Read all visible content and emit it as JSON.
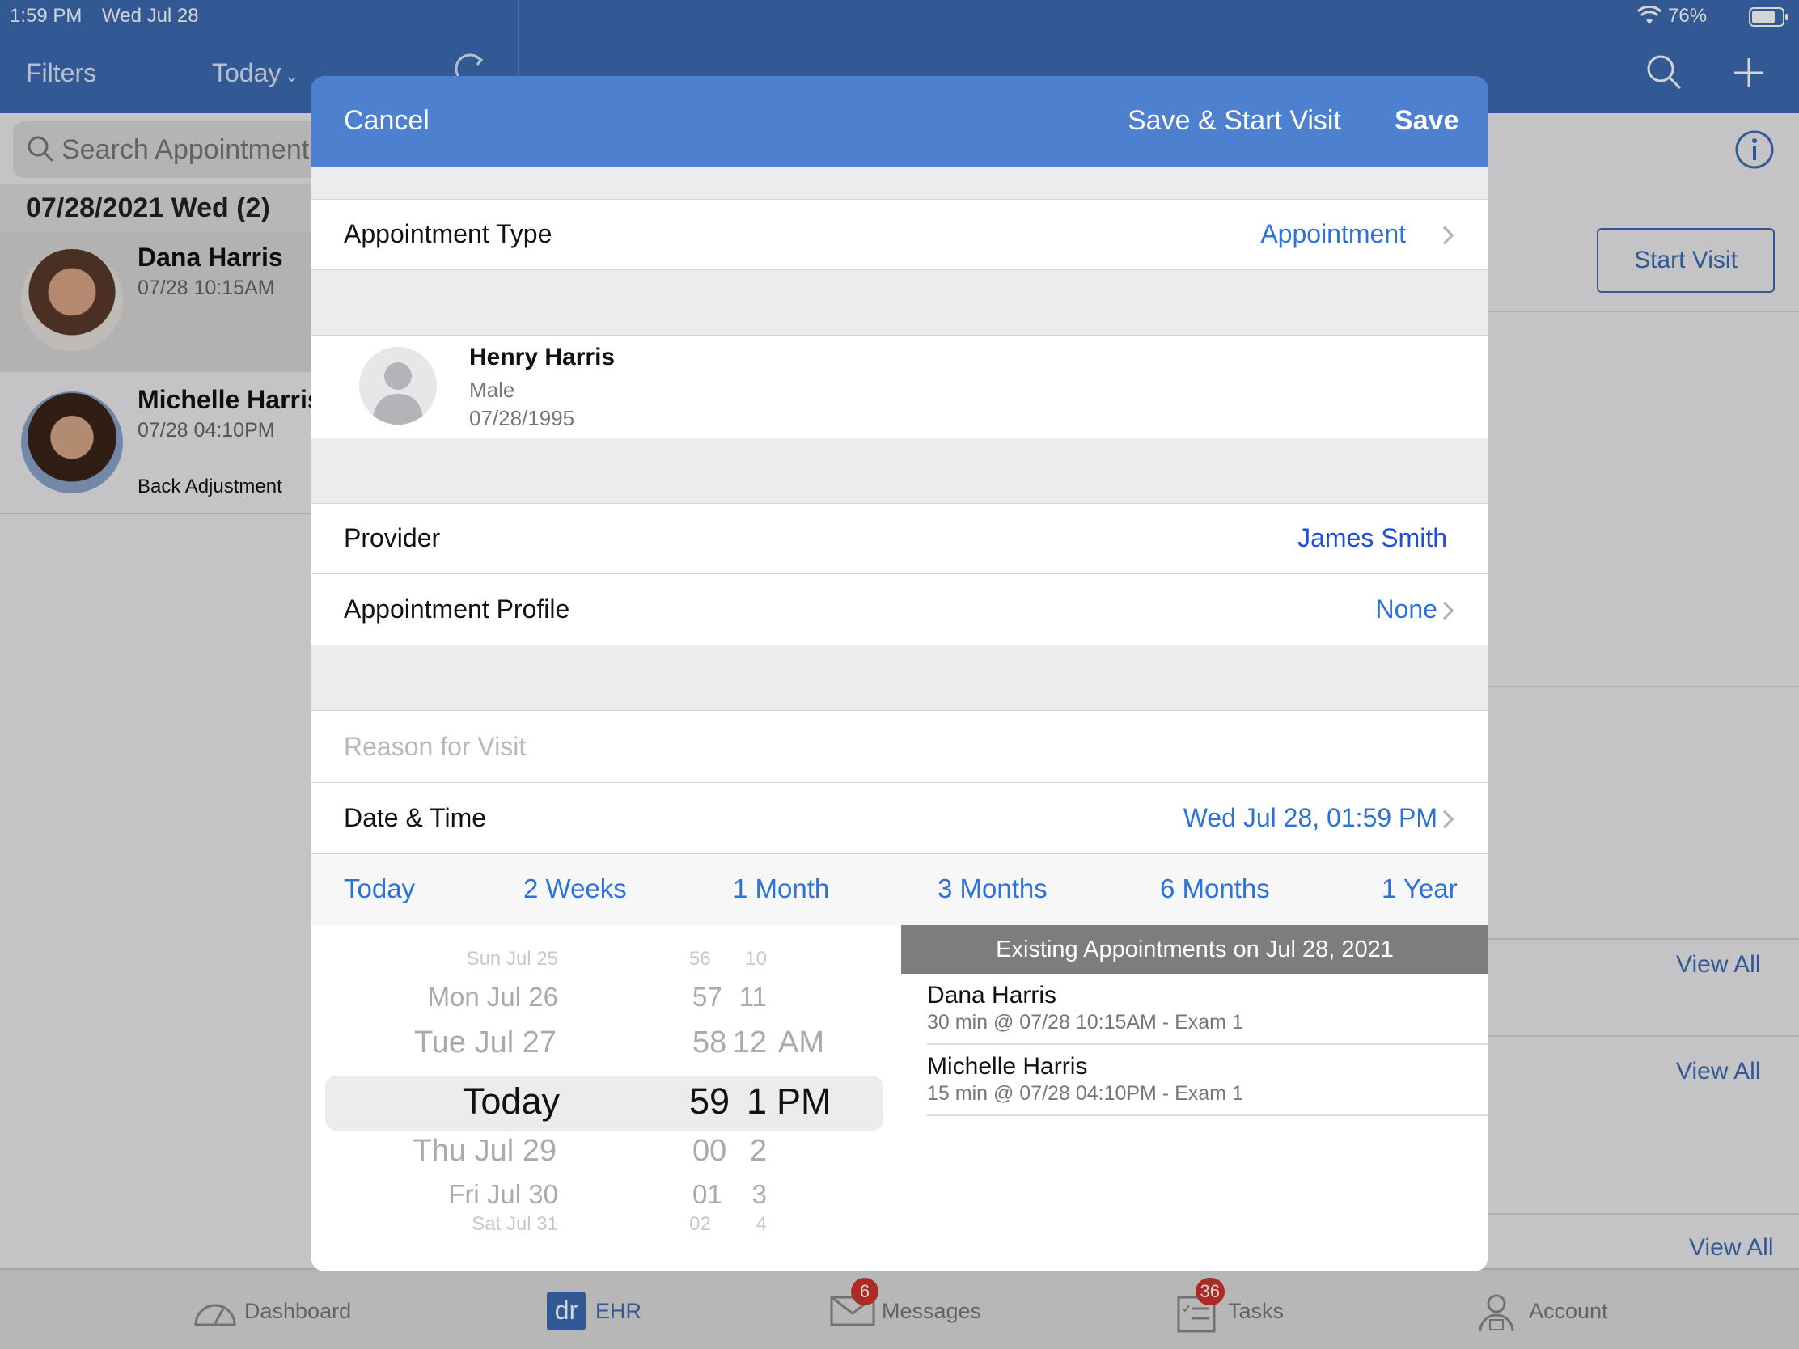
{
  "status_bar": {
    "time": "1:59 PM",
    "date": "Wed Jul 28",
    "battery": "76%"
  },
  "topbar": {
    "filters_label": "Filters",
    "today_label": "Today"
  },
  "search": {
    "placeholder": "Search Appointment"
  },
  "list": {
    "date_header": "07/28/2021 Wed (2)",
    "items": [
      {
        "name": "Dana Harris",
        "time": "07/28 10:15AM",
        "note": ""
      },
      {
        "name": "Michelle Harris",
        "time": "07/28 04:10PM",
        "note": "Back Adjustment"
      }
    ]
  },
  "detail": {
    "start_visit_label": "Start Visit",
    "view_all_labels": [
      "View All",
      "View All",
      "View All"
    ]
  },
  "modal": {
    "cancel_label": "Cancel",
    "save_start_label": "Save & Start Visit",
    "save_label": "Save",
    "appointment_type": {
      "label": "Appointment Type",
      "value": "Appointment"
    },
    "patient": {
      "name": "Henry Harris",
      "gender": "Male",
      "dob": "07/28/1995"
    },
    "provider": {
      "label": "Provider",
      "value": "James Smith"
    },
    "appointment_profile": {
      "label": "Appointment Profile",
      "value": "None"
    },
    "reason": {
      "placeholder": "Reason for Visit"
    },
    "date_time": {
      "label": "Date & Time",
      "value": "Wed Jul 28, 01:59 PM"
    },
    "quick_ranges": [
      "Today",
      "2 Weeks",
      "1 Month",
      "3 Months",
      "6 Months",
      "1 Year"
    ],
    "picker": {
      "days": [
        "Sun Jul 25",
        "Mon Jul 26",
        "Tue Jul 27",
        "Today",
        "Thu Jul 29",
        "Fri Jul 30",
        "Sat Jul 31"
      ],
      "hours": [
        "10",
        "11",
        "12",
        "1",
        "2",
        "3",
        "4"
      ],
      "minutes": [
        "56",
        "57",
        "58",
        "59",
        "00",
        "01",
        "02"
      ],
      "ampm": [
        "AM",
        "PM"
      ]
    },
    "existing": {
      "title": "Existing Appointments on Jul 28, 2021",
      "items": [
        {
          "name": "Dana Harris",
          "detail": "30 min @ 07/28 10:15AM - Exam 1"
        },
        {
          "name": "Michelle Harris",
          "detail": "15 min @ 07/28 04:10PM - Exam 1"
        }
      ]
    }
  },
  "tabbar": {
    "items": [
      {
        "label": "Dashboard",
        "icon": "speedometer-icon",
        "badge": ""
      },
      {
        "label": "EHR",
        "icon": "ehr-dr-icon",
        "badge": ""
      },
      {
        "label": "Messages",
        "icon": "envelope-icon",
        "badge": "6"
      },
      {
        "label": "Tasks",
        "icon": "checklist-icon",
        "badge": "36"
      },
      {
        "label": "Account",
        "icon": "user-lock-icon",
        "badge": ""
      }
    ],
    "ehr_icon_text": "dr"
  },
  "colors": {
    "brand": "#3d6bb3",
    "modal_header": "#4d80cf",
    "link": "#2d72d9",
    "badge": "#d0342c"
  }
}
